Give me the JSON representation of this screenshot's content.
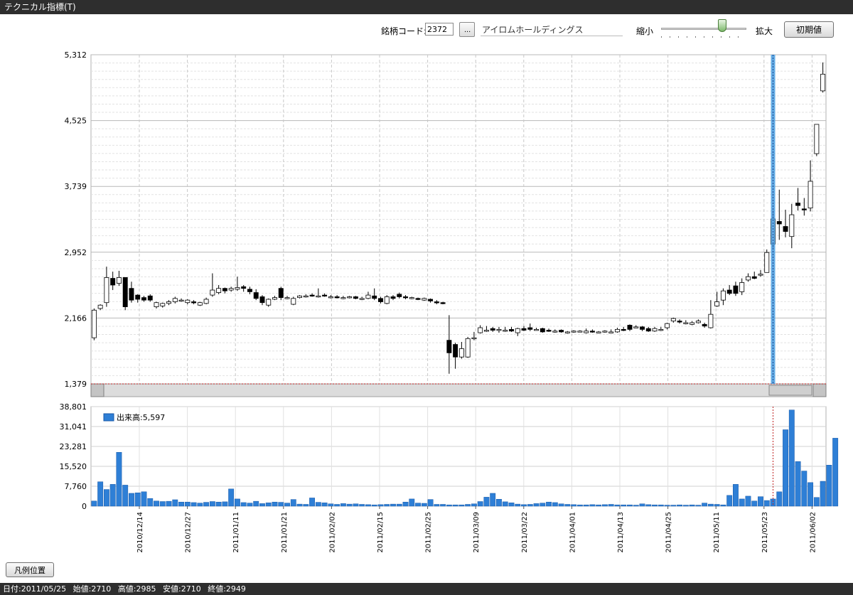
{
  "window": {
    "title": "テクニカル指標(T)"
  },
  "toolbar": {
    "code_label": "銘柄コード:",
    "code_value": "2372",
    "browse_label": "...",
    "company_name": "アイロムホールディングス",
    "shrink_label": "縮小",
    "enlarge_label": "拡大",
    "reset_label": "初期値",
    "zoom_level": 0.72
  },
  "legend_button_label": "凡例位置",
  "status": {
    "date": "日付:2011/05/25",
    "open": "始値:2710",
    "high": "高値:2985",
    "low": "安値:2710",
    "close": "終値:2949"
  },
  "colors": {
    "volume_bar": "#2e7fd6",
    "cursor_line": "#4a9fe0",
    "grid": "#c8c8c8",
    "up_candle": "#ffffff",
    "down_candle": "#000000"
  },
  "chart_data": [
    {
      "type": "candlestick",
      "y_ticks": [
        "5,312",
        "4,525",
        "3,739",
        "2,952",
        "2,166",
        "1,379"
      ],
      "ylim": [
        1379,
        5312
      ],
      "x_tick_labels": [
        "2010/12/14",
        "2010/12/27",
        "2011/01/11",
        "2011/01/21",
        "2011/02/02",
        "2011/02/15",
        "2011/02/25",
        "2011/03/09",
        "2011/03/22",
        "2011/04/01",
        "2011/04/13",
        "2011/04/25",
        "2011/05/11",
        "2011/05/23",
        "2011/06/02"
      ],
      "grid": true,
      "cursor_date": "2011/05/25",
      "candles": [
        [
          1930,
          2260,
          1900,
          2280
        ],
        [
          2280,
          2320,
          2260,
          2330
        ],
        [
          2350,
          2650,
          2300,
          2780
        ],
        [
          2640,
          2560,
          2500,
          2720
        ],
        [
          2580,
          2650,
          2550,
          2730
        ],
        [
          2650,
          2300,
          2260,
          2650
        ],
        [
          2520,
          2380,
          2350,
          2600
        ],
        [
          2440,
          2390,
          2350,
          2450
        ],
        [
          2410,
          2380,
          2360,
          2430
        ],
        [
          2430,
          2380,
          2360,
          2450
        ],
        [
          2300,
          2350,
          2280,
          2360
        ],
        [
          2310,
          2340,
          2290,
          2350
        ],
        [
          2340,
          2360,
          2320,
          2380
        ],
        [
          2360,
          2400,
          2340,
          2420
        ],
        [
          2380,
          2380,
          2360,
          2400
        ],
        [
          2350,
          2380,
          2330,
          2390
        ],
        [
          2360,
          2350,
          2330,
          2380
        ],
        [
          2320,
          2350,
          2310,
          2360
        ],
        [
          2340,
          2390,
          2330,
          2410
        ],
        [
          2440,
          2500,
          2420,
          2700
        ],
        [
          2470,
          2520,
          2450,
          2560
        ],
        [
          2520,
          2490,
          2460,
          2530
        ],
        [
          2500,
          2520,
          2480,
          2540
        ],
        [
          2510,
          2530,
          2490,
          2660
        ],
        [
          2540,
          2520,
          2480,
          2560
        ],
        [
          2510,
          2480,
          2450,
          2540
        ],
        [
          2470,
          2400,
          2380,
          2510
        ],
        [
          2420,
          2350,
          2320,
          2440
        ],
        [
          2320,
          2390,
          2300,
          2400
        ],
        [
          2390,
          2410,
          2380,
          2430
        ],
        [
          2520,
          2410,
          2380,
          2540
        ],
        [
          2410,
          2410,
          2390,
          2430
        ],
        [
          2330,
          2400,
          2320,
          2420
        ],
        [
          2410,
          2430,
          2400,
          2440
        ],
        [
          2430,
          2430,
          2410,
          2450
        ],
        [
          2440,
          2430,
          2420,
          2460
        ],
        [
          2430,
          2430,
          2410,
          2520
        ],
        [
          2440,
          2430,
          2420,
          2460
        ],
        [
          2420,
          2420,
          2400,
          2440
        ],
        [
          2420,
          2410,
          2400,
          2440
        ],
        [
          2410,
          2410,
          2390,
          2430
        ],
        [
          2410,
          2420,
          2400,
          2430
        ],
        [
          2420,
          2400,
          2390,
          2430
        ],
        [
          2390,
          2400,
          2380,
          2420
        ],
        [
          2400,
          2440,
          2390,
          2480
        ],
        [
          2430,
          2400,
          2380,
          2520
        ],
        [
          2400,
          2360,
          2340,
          2420
        ],
        [
          2340,
          2420,
          2330,
          2440
        ],
        [
          2420,
          2400,
          2380,
          2440
        ],
        [
          2450,
          2420,
          2400,
          2470
        ],
        [
          2420,
          2410,
          2390,
          2440
        ],
        [
          2400,
          2410,
          2390,
          2420
        ],
        [
          2400,
          2390,
          2380,
          2410
        ],
        [
          2380,
          2400,
          2370,
          2410
        ],
        [
          2390,
          2370,
          2350,
          2400
        ],
        [
          2360,
          2350,
          2330,
          2380
        ],
        [
          2350,
          2340,
          2330,
          2360
        ],
        [
          1900,
          1750,
          1500,
          2200
        ],
        [
          1850,
          1700,
          1560,
          1870
        ],
        [
          1700,
          1800,
          1680,
          1880
        ],
        [
          1700,
          1920,
          1690,
          1940
        ],
        [
          1930,
          1930,
          1900,
          2000
        ],
        [
          1990,
          2050,
          1980,
          2080
        ],
        [
          2020,
          2020,
          2000,
          2070
        ],
        [
          2040,
          2020,
          2000,
          2060
        ],
        [
          2030,
          2030,
          1990,
          2060
        ],
        [
          2020,
          2020,
          2000,
          2060
        ],
        [
          2030,
          2010,
          2000,
          2060
        ],
        [
          1990,
          2040,
          1950,
          2050
        ],
        [
          2040,
          2020,
          2010,
          2070
        ],
        [
          2050,
          2030,
          2010,
          2100
        ],
        [
          2030,
          2030,
          2020,
          2050
        ],
        [
          2040,
          2000,
          1990,
          2050
        ],
        [
          2020,
          2010,
          2000,
          2040
        ],
        [
          2000,
          2010,
          1990,
          2030
        ],
        [
          2020,
          2000,
          1990,
          2030
        ],
        [
          2000,
          2000,
          1980,
          2010
        ],
        [
          2000,
          2010,
          1990,
          2020
        ],
        [
          2010,
          2010,
          2000,
          2020
        ],
        [
          1990,
          2010,
          1980,
          2040
        ],
        [
          2010,
          2000,
          1990,
          2030
        ],
        [
          2000,
          2000,
          1990,
          2010
        ],
        [
          2000,
          2010,
          1990,
          2020
        ],
        [
          2000,
          2000,
          1990,
          2030
        ],
        [
          2000,
          2030,
          1990,
          2050
        ],
        [
          2030,
          2020,
          2010,
          2060
        ],
        [
          2080,
          2030,
          2010,
          2090
        ],
        [
          2060,
          2060,
          2050,
          2080
        ],
        [
          2060,
          2030,
          2010,
          2070
        ],
        [
          2040,
          2010,
          2000,
          2060
        ],
        [
          2010,
          2040,
          2000,
          2060
        ],
        [
          2030,
          2030,
          2010,
          2060
        ],
        [
          2050,
          2100,
          2030,
          2110
        ],
        [
          2130,
          2160,
          2110,
          2170
        ],
        [
          2130,
          2120,
          2100,
          2150
        ],
        [
          2110,
          2110,
          2090,
          2140
        ],
        [
          2090,
          2110,
          2080,
          2130
        ],
        [
          2110,
          2130,
          2100,
          2150
        ],
        [
          2090,
          2070,
          2050,
          2110
        ],
        [
          2050,
          2210,
          2040,
          2380
        ],
        [
          2310,
          2360,
          2300,
          2480
        ],
        [
          2380,
          2490,
          2320,
          2520
        ],
        [
          2500,
          2460,
          2440,
          2560
        ],
        [
          2550,
          2460,
          2430,
          2600
        ],
        [
          2480,
          2590,
          2440,
          2640
        ],
        [
          2620,
          2660,
          2600,
          2700
        ],
        [
          2660,
          2640,
          2630,
          2720
        ],
        [
          2680,
          2690,
          2660,
          2740
        ],
        [
          2710,
          2949,
          2710,
          2985
        ],
        [
          3050,
          3350,
          3000,
          3450
        ],
        [
          3320,
          3290,
          3100,
          3700
        ],
        [
          3260,
          3200,
          3130,
          3460
        ],
        [
          3140,
          3400,
          3000,
          3530
        ],
        [
          3540,
          3510,
          3450,
          3720
        ],
        [
          3470,
          3460,
          3390,
          3600
        ],
        [
          3480,
          3800,
          3440,
          4050
        ],
        [
          4130,
          4480,
          4100,
          4480
        ],
        [
          4880,
          5080,
          4860,
          5220
        ]
      ],
      "volume": {
        "legend": "出来高:5,597",
        "y_ticks": [
          "38,801",
          "31,041",
          "23,281",
          "15,520",
          "7,760",
          "0"
        ],
        "ylim": [
          0,
          38801
        ],
        "values": [
          2000,
          9500,
          6500,
          8500,
          21000,
          8200,
          5000,
          5200,
          5600,
          3000,
          2000,
          1800,
          1900,
          2500,
          1600,
          1600,
          1400,
          1200,
          1500,
          1800,
          1600,
          1700,
          6700,
          2800,
          1400,
          1200,
          1900,
          1000,
          1300,
          1600,
          1500,
          1200,
          2600,
          800,
          700,
          3200,
          1500,
          1300,
          900,
          700,
          1000,
          800,
          900,
          700,
          600,
          500,
          600,
          700,
          800,
          800,
          1600,
          2800,
          1200,
          1100,
          2600,
          700,
          700,
          500,
          500,
          500,
          700,
          900,
          1800,
          3500,
          5000,
          2700,
          1700,
          1300,
          800,
          600,
          700,
          1000,
          1200,
          1600,
          1400,
          900,
          700,
          600,
          500,
          500,
          600,
          500,
          600,
          700,
          500,
          500,
          500,
          400,
          900,
          600,
          500,
          500,
          400,
          400,
          500,
          400,
          500,
          400,
          1200,
          800,
          700,
          500,
          4200,
          8500,
          2800,
          3900,
          2000,
          3700,
          2200,
          2800,
          5597,
          29800,
          37500,
          17400,
          13700,
          9200,
          3400,
          9700,
          16000,
          26500
        ]
      }
    }
  ]
}
